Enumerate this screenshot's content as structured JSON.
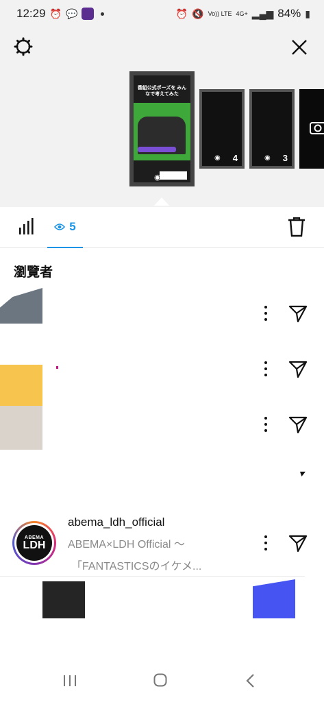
{
  "status_bar": {
    "time": "12:29",
    "battery": "84%",
    "network_top": "4G+",
    "volte": "Vo)) LTE"
  },
  "header": {
    "main_story_title": "番組公式ポーズを みんなで考えてみた",
    "story_counts": [
      "4",
      "3"
    ]
  },
  "tabs": {
    "viewers_count": "5"
  },
  "section_title": "瀏覽者",
  "viewer": {
    "username": "abema_ldh_official",
    "fullname": "ABEMA×LDH Official ～",
    "note": "「FANTASTICSのイケメ...",
    "avatar_line1": "ABEMA",
    "avatar_line2": "LDH"
  },
  "colors": {
    "accent": "#1a94e6",
    "header_bg": "#f2f2f2"
  },
  "icons": {
    "settings": "gear-icon",
    "close": "close-icon",
    "stats": "bar-chart-icon",
    "eye": "eye-icon",
    "delete": "trash-icon",
    "more": "more-vertical-icon",
    "send": "send-icon"
  }
}
